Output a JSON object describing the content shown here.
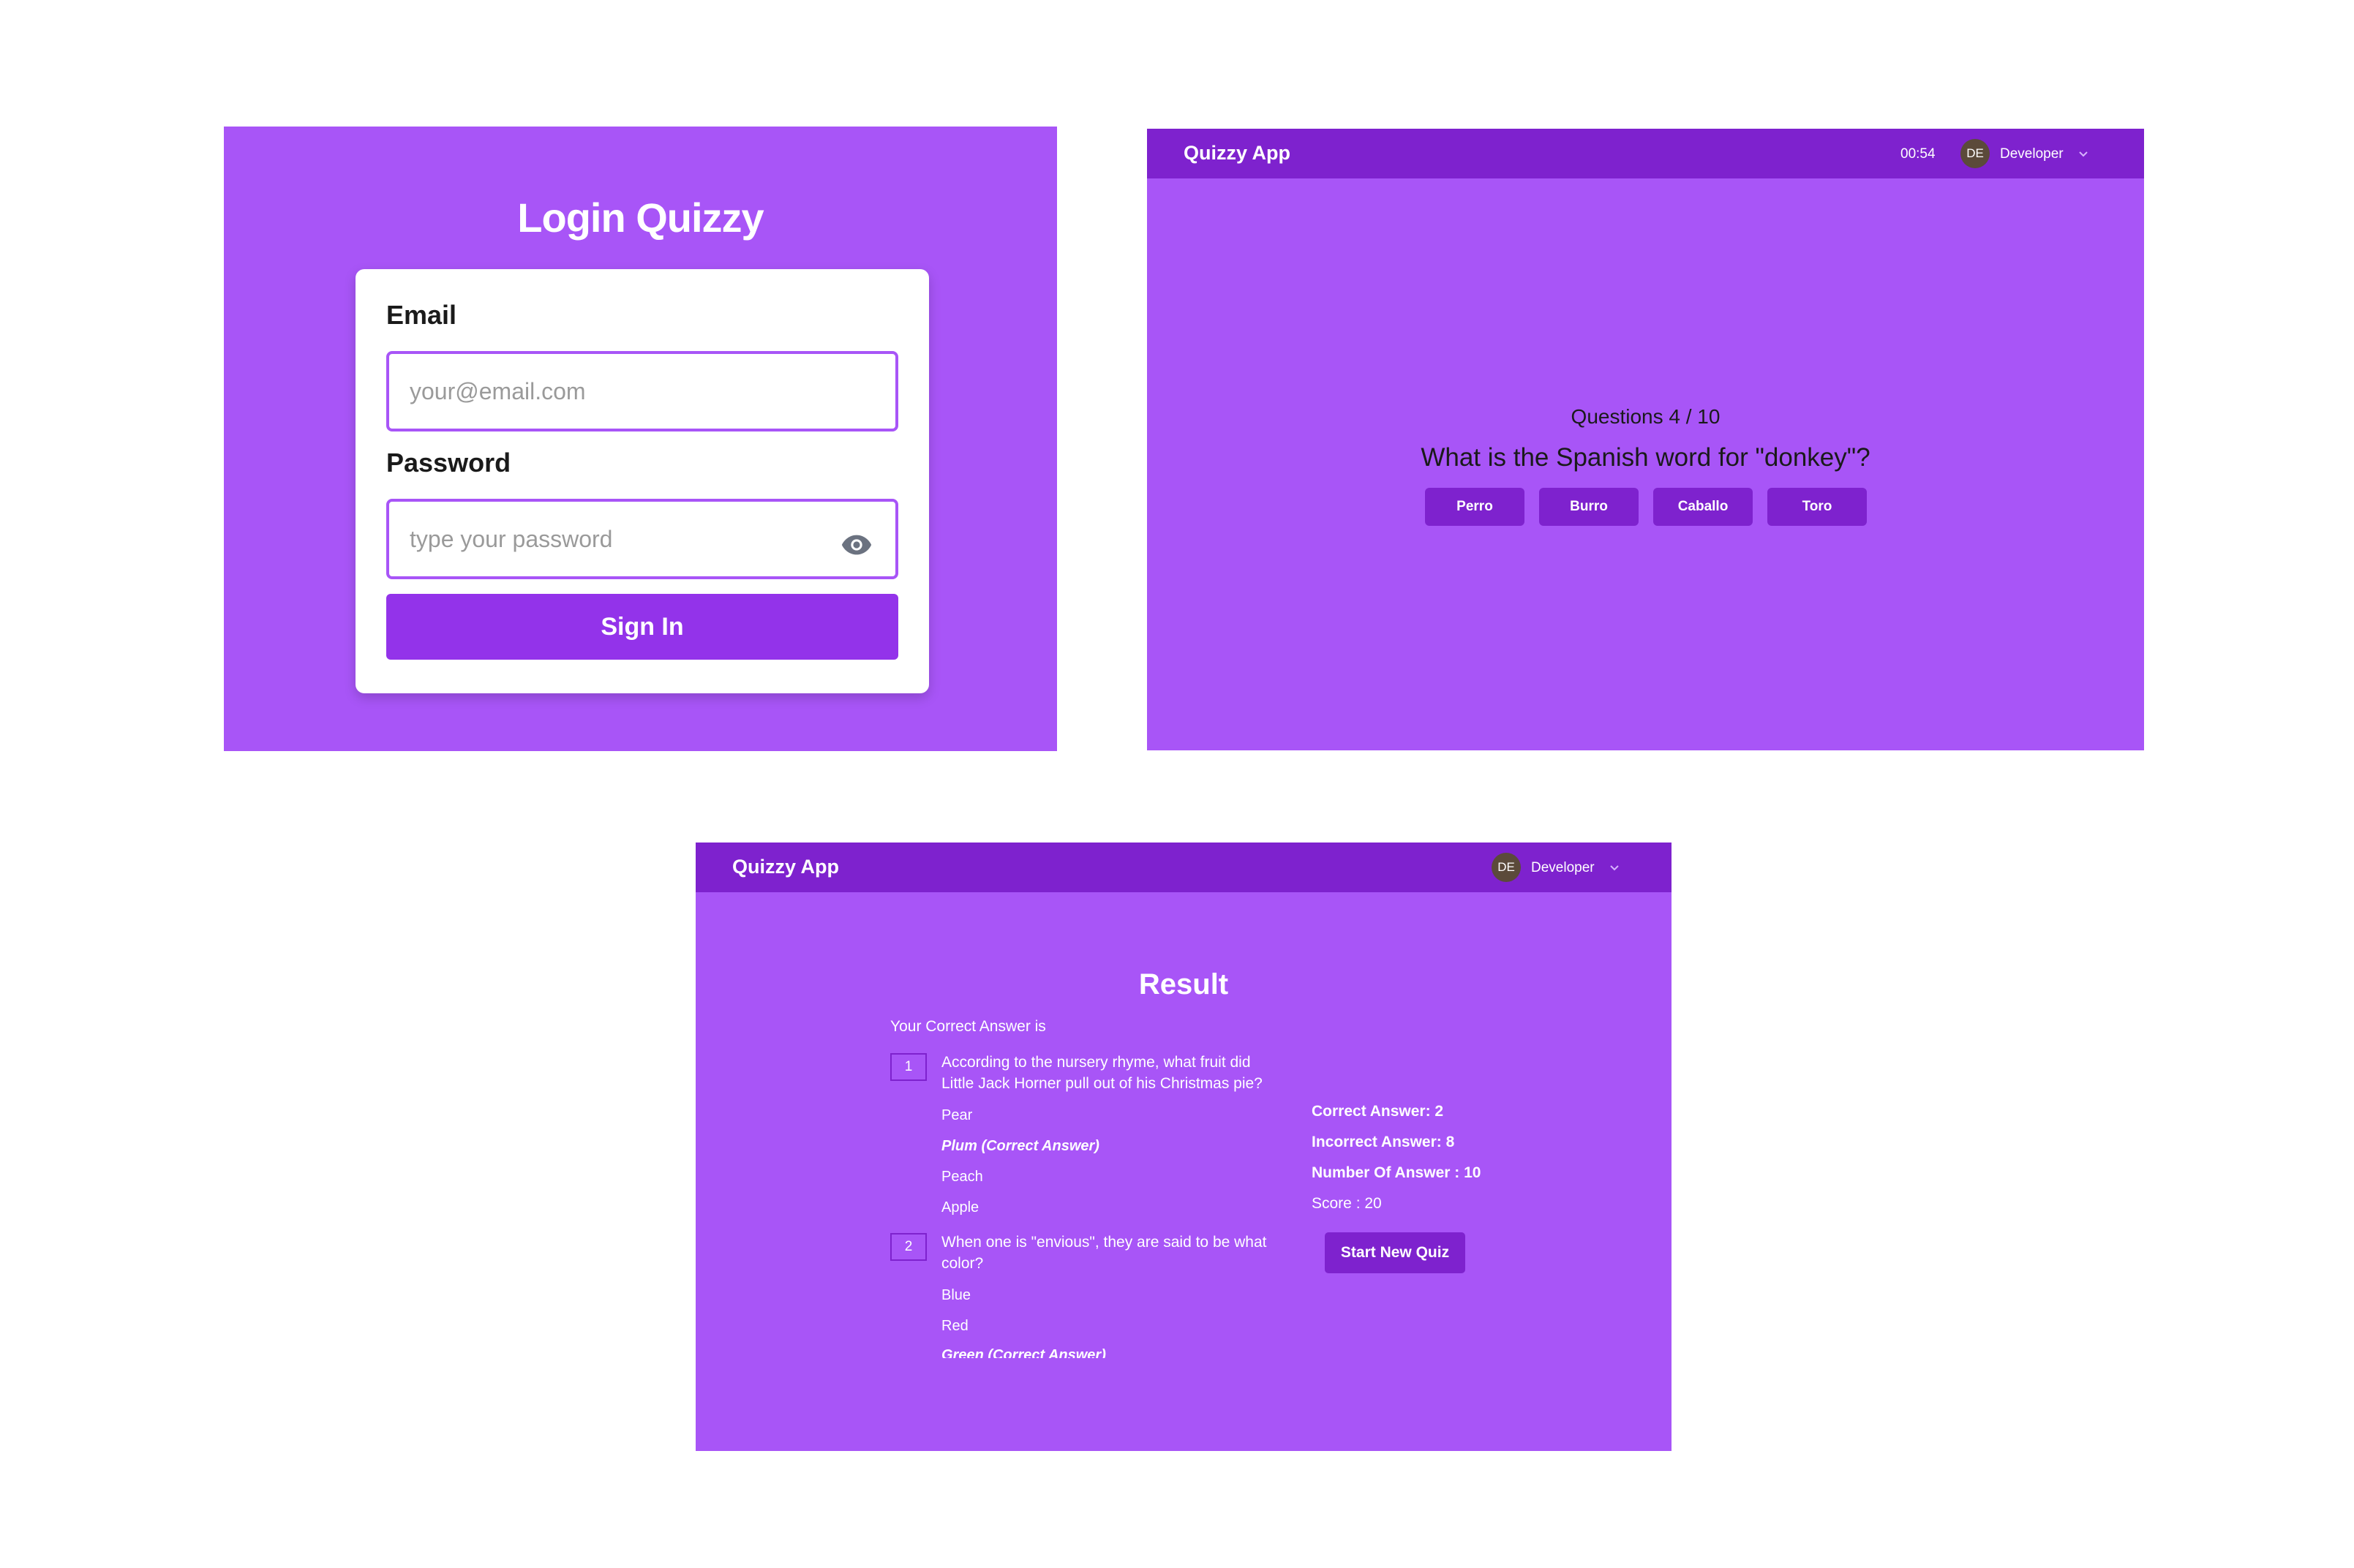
{
  "login": {
    "title": "Login Quizzy",
    "email_label": "Email",
    "email_placeholder": "your@email.com",
    "email_value": "",
    "password_label": "Password",
    "password_placeholder": "type your password",
    "password_value": "",
    "signin_label": "Sign In",
    "icons": {
      "password_toggle": "eye-icon"
    }
  },
  "quiz": {
    "app_name": "Quizzy App",
    "timer": "00:54",
    "user_initials": "DE",
    "user_name": "Developer",
    "counter": "Questions 4 / 10",
    "question": "What is the Spanish word for \"donkey\"?",
    "answers": [
      "Perro",
      "Burro",
      "Caballo",
      "Toro"
    ]
  },
  "result": {
    "app_name": "Quizzy App",
    "user_initials": "DE",
    "user_name": "Developer",
    "title": "Result",
    "subtitle": "Your Correct Answer is",
    "questions": [
      {
        "number": "1",
        "text": "According to the nursery rhyme, what fruit did Little Jack Horner pull out of his Christmas pie?",
        "options": [
          "Pear",
          "Plum (Correct Answer)",
          "Peach",
          "Apple"
        ]
      },
      {
        "number": "2",
        "text": "When one is \"envious\", they are said to be what color?",
        "options": [
          "Blue",
          "Red",
          "Green (Correct Answer)"
        ]
      }
    ],
    "stats": {
      "correct": "Correct Answer: 2",
      "incorrect": "Incorrect Answer: 8",
      "total": "Number Of Answer : 10",
      "score": "Score : 20"
    },
    "start_new_label": "Start New Quiz"
  },
  "colors": {
    "panel_bg": "#a855f7",
    "navbar_bg": "#7e22ce",
    "button_bg": "#7e22ce",
    "signin_bg": "#9333ea",
    "input_border": "#a855f7"
  }
}
